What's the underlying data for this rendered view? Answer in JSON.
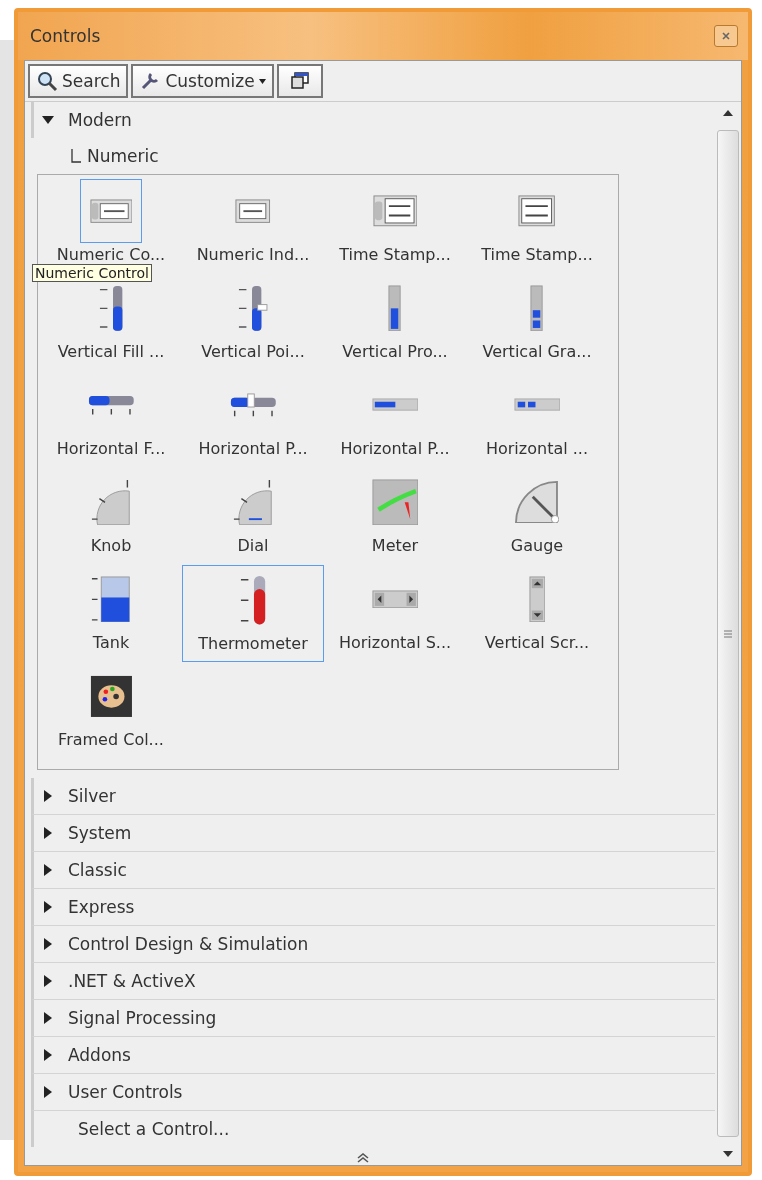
{
  "window": {
    "title": "Controls"
  },
  "toolbar": [
    {
      "kind": "search",
      "label": "Search"
    },
    {
      "kind": "customize",
      "label": "Customize"
    },
    {
      "kind": "view"
    }
  ],
  "modern": {
    "label": "Modern",
    "expanded": true,
    "children": [
      {
        "label": "Numeric"
      }
    ]
  },
  "tooltip": "Numeric Control",
  "palette": [
    {
      "kind": "numeric-control",
      "label": "Numeric Co...",
      "selected": true
    },
    {
      "kind": "numeric-indicator",
      "label": "Numeric Ind...",
      "selected": false
    },
    {
      "kind": "timestamp-control",
      "label": "Time Stamp...",
      "selected": false
    },
    {
      "kind": "timestamp-indicator",
      "label": "Time Stamp...",
      "selected": false
    },
    {
      "kind": "vertical-fill",
      "label": "Vertical Fill ...",
      "selected": false
    },
    {
      "kind": "vertical-pointer",
      "label": "Vertical Poi...",
      "selected": false
    },
    {
      "kind": "vertical-progress",
      "label": "Vertical Pro...",
      "selected": false
    },
    {
      "kind": "vertical-graduated",
      "label": "Vertical Gra...",
      "selected": false
    },
    {
      "kind": "horizontal-fill",
      "label": "Horizontal F...",
      "selected": false
    },
    {
      "kind": "horizontal-pointer",
      "label": "Horizontal P...",
      "selected": false
    },
    {
      "kind": "horizontal-progress",
      "label": "Horizontal P...",
      "selected": false
    },
    {
      "kind": "horizontal-graduated",
      "label": "Horizontal ...",
      "selected": false
    },
    {
      "kind": "knob",
      "label": "Knob",
      "selected": false
    },
    {
      "kind": "dial",
      "label": "Dial",
      "selected": false
    },
    {
      "kind": "meter",
      "label": "Meter",
      "selected": false
    },
    {
      "kind": "gauge",
      "label": "Gauge",
      "selected": false
    },
    {
      "kind": "tank",
      "label": "Tank",
      "selected": false
    },
    {
      "kind": "thermometer",
      "label": "Thermometer",
      "selected": true
    },
    {
      "kind": "hscroll",
      "label": "Horizontal S...",
      "selected": false
    },
    {
      "kind": "vscroll",
      "label": "Vertical Scr...",
      "selected": false
    },
    {
      "kind": "color-box",
      "label": "Framed Col...",
      "selected": false
    }
  ],
  "categories": [
    {
      "label": "Silver",
      "expanded": false
    },
    {
      "label": "System",
      "expanded": false
    },
    {
      "label": "Classic",
      "expanded": false
    },
    {
      "label": "Express",
      "expanded": false
    },
    {
      "label": "Control Design & Simulation",
      "expanded": false
    },
    {
      "label": ".NET & ActiveX",
      "expanded": false
    },
    {
      "label": "Signal Processing",
      "expanded": false
    },
    {
      "label": "Addons",
      "expanded": false
    },
    {
      "label": "User Controls",
      "expanded": false
    }
  ],
  "footer": {
    "label": "Select a Control..."
  }
}
